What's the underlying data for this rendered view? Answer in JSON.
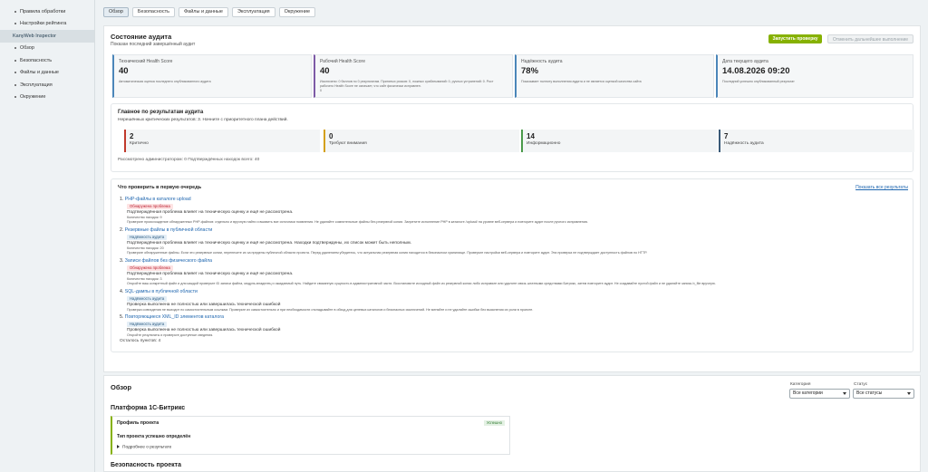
{
  "sidebar": {
    "items": [
      {
        "label": "Правила обработки"
      },
      {
        "label": "Настройки рейтинга"
      },
      {
        "label": "KanyWeb Inspector"
      },
      {
        "label": "Обзор"
      },
      {
        "label": "Безопасность"
      },
      {
        "label": "Файлы и данные"
      },
      {
        "label": "Эксплуатация"
      },
      {
        "label": "Окружение"
      }
    ]
  },
  "tabs": [
    {
      "label": "Обзор",
      "active": true
    },
    {
      "label": "Безопасность"
    },
    {
      "label": "Файлы и данные"
    },
    {
      "label": "Эксплуатация"
    },
    {
      "label": "Окружение"
    }
  ],
  "audit": {
    "title": "Состояние аудита",
    "subtitle": "Показан последний завершённый аудит",
    "run_button": "Запустить проверку",
    "cancel_button": "Отменить дальнейшее выполнение",
    "metrics": [
      {
        "label": "Технический Health Score",
        "value": "40",
        "desc": "Автоматическая оценка последнего опубликованного аудита",
        "color": "#4b86b9"
      },
      {
        "label": "Рабочий Health Score",
        "value": "40",
        "desc": "Исключено: 0 баллов по 0 результатам. Принятых рисков: 0, ложных срабатываний: 0, ручных устранений: 0. Рост рабочего Health Score не означает, что сайт физически исправлен.",
        "desc2": "0",
        "color": "#7d5aa6"
      },
      {
        "label": "Надёжность аудита",
        "value": "78%",
        "desc": "Показывает полноту выполнения аудита и не является оценкой качества сайта",
        "color": "#4b86b9"
      },
      {
        "label": "Дата текущего аудита",
        "value": "14.08.2026 09:20",
        "desc": "Последний успешно опубликованный результат",
        "color": "#4b86b9"
      }
    ]
  },
  "summary": {
    "title": "Главное по результатам аудита",
    "text": "Нерешённых критических результатов: 3. Начните с приоритетного плана действий.",
    "boxes": [
      {
        "count": "2",
        "label": "Критично",
        "color": "#c0392b"
      },
      {
        "count": "0",
        "label": "Требуют внимания",
        "color": "#d4a017"
      },
      {
        "count": "14",
        "label": "Информационно",
        "color": "#4a9a4a"
      },
      {
        "count": "7",
        "label": "Надёжность аудита",
        "color": "#3a5a78"
      }
    ],
    "footer": "Рассмотрено администратором: 0     Подтверждённых находок всего: 40"
  },
  "check": {
    "title": "Что проверить в первую очередь",
    "show_all": "Показать все результаты",
    "items": [
      {
        "num": "1.",
        "title": "PHP-файлы в каталоге upload",
        "badge": "Обнаружена проблема",
        "badge_type": "red",
        "line1": "Подтверждённая проблема влияет на техническую оценку и ещё не рассмотрена.",
        "line2": "Количество находок: 9",
        "line3": "Проверьте происхождение обнаруженных PHP-файлов: отдельно и вручную найти и выявить все источники появления. Не удаляйте сомнительные файлы без резервной копии. Запретите исполнение PHP в каталоге /upload/ на уровне веб-сервера и повторите аудит после ручного исправления."
      },
      {
        "num": "2.",
        "title": "Резервные файлы в публичной области",
        "badge": "Надёжность аудита",
        "badge_type": "blue",
        "line1": "Подтверждённая проблема влияет на техническую оценку и ещё не рассмотрена. Находки подтверждены, их список может быть неполным.",
        "line2": "Количество находок: 20",
        "line3": "Проверьте обнаруженные файлы. Если это резервные копии, перенесите их за пределы публичной области проекта. Перед удалением убедитесь, что актуальная резервная копия находится в безопасном хранилище. Проверьте настройки веб-сервера и повторите аудит. Эта проверка не подтверждает доступность файлов по HTTP."
      },
      {
        "num": "3.",
        "title": "Записи файлов без физического файла",
        "badge": "Обнаружена проблема",
        "badge_type": "red",
        "line1": "Подтверждённая проблема влияет на техническую оценку и ещё не рассмотрена.",
        "line2": "Количество находок: 3",
        "line3": "Откройте ваш конкретный файл и для каждой проверьте ID записи файла, модуль-владелец и ожидаемый путь. Найдите связанную сущность в административной части. Восстановите исходный файл из резервной копии либо исправьте или удалите связь штатными средствами Битрикс, затем повторите аудит. Не создавайте пустой файл и не удаляйте запись b_file вручную."
      },
      {
        "num": "4.",
        "title": "SQL-дампы в публичной области",
        "badge": "Надёжность аудита",
        "badge_type": "blue",
        "line1": "Проверка выполнена не полностью или завершилась технической ошибкой",
        "line2": "Проверка совпадения не выходит по самостоятельным ссылкам. Проверьте их самостоятельно и при необходимости откладывайте в обход для целевых каталогов и безопасных исключений. Не меняйте и не удаляйте ошибки без выяснения их роли в проекте."
      },
      {
        "num": "5.",
        "title": "Повторяющиеся XML_ID элементов каталога",
        "badge": "Надёжность аудита",
        "badge_type": "blue",
        "line1": "Проверка выполнена не полностью или завершилась технической ошибкой",
        "line2": "Откройте результаты и проверьте доступные сведения."
      }
    ],
    "rest": "Осталось пунктов: 4"
  },
  "overview": {
    "title": "Обзор",
    "category_label": "Категория",
    "category_value": "Все категории",
    "status_label": "Статус",
    "status_value": "Все статусы",
    "platform_title": "Платформа 1С-Битрикс",
    "card": {
      "title": "Профиль проекта",
      "badge": "Успешно",
      "status": "Тип проекта успешно определён",
      "details": "Подробнее о результате"
    },
    "security_title": "Безопасность проекта"
  }
}
